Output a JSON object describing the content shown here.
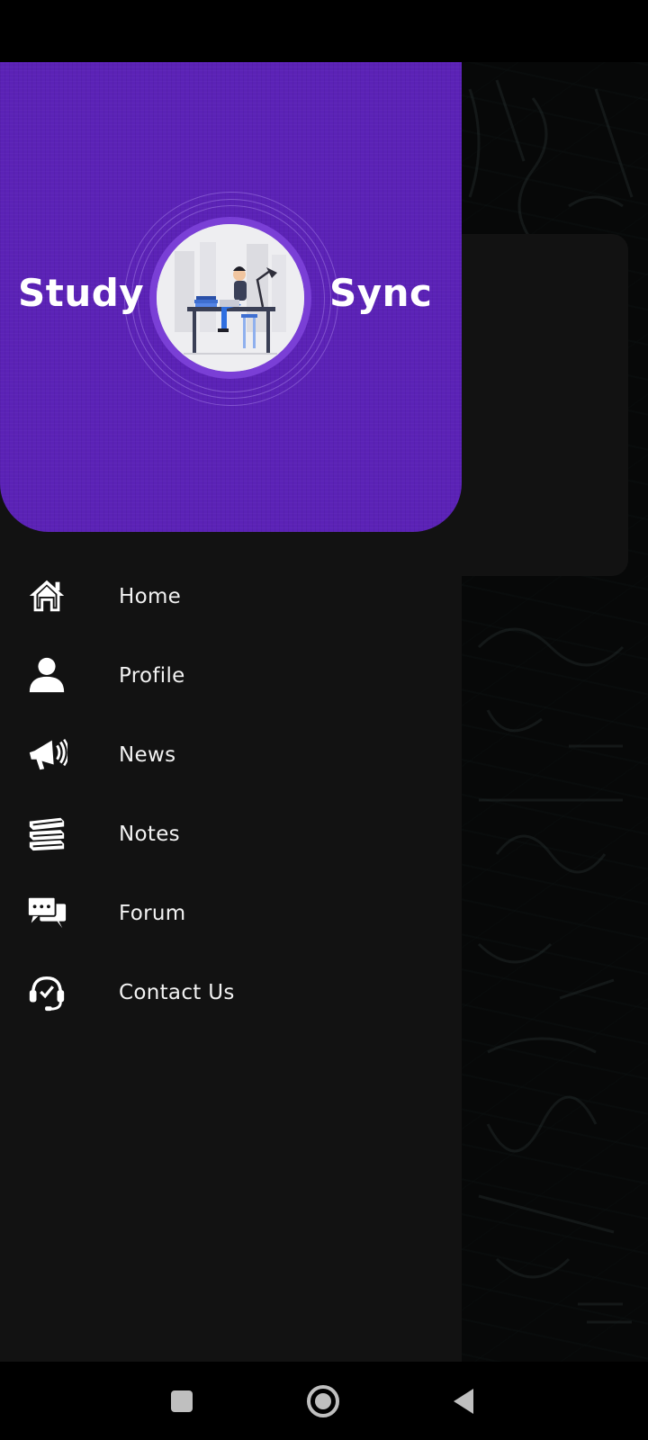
{
  "header": {
    "brand_left": "Study",
    "brand_right": "Sync"
  },
  "menu": {
    "items": [
      {
        "label": "Home",
        "icon": "home-icon"
      },
      {
        "label": "Profile",
        "icon": "person-icon"
      },
      {
        "label": "News",
        "icon": "megaphone-icon"
      },
      {
        "label": "Notes",
        "icon": "books-icon"
      },
      {
        "label": "Forum",
        "icon": "chat-bubbles-icon"
      },
      {
        "label": "Contact Us",
        "icon": "headset-icon"
      }
    ]
  },
  "colors": {
    "accent": "#5b22b6",
    "drawer_bg": "#121212",
    "text": "#f2f2f2"
  },
  "nav_bar": {
    "buttons": [
      "recents-button",
      "home-button",
      "back-button"
    ]
  }
}
